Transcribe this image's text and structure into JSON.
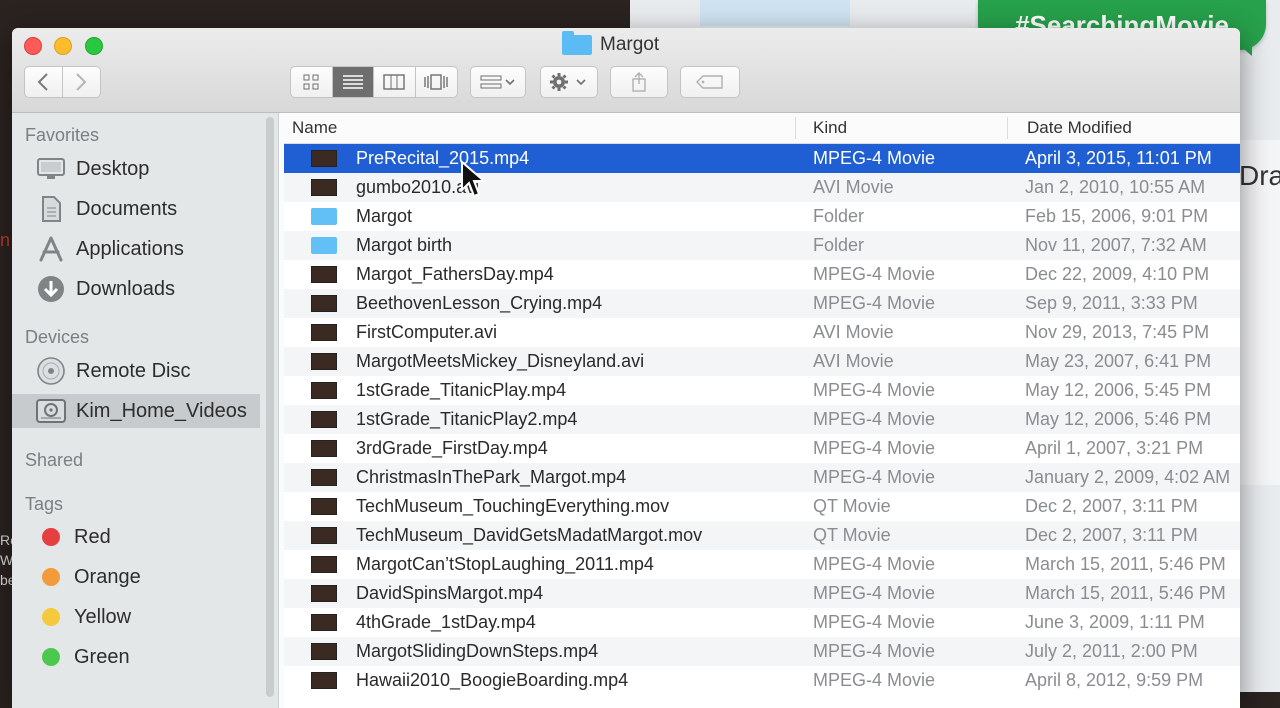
{
  "hashtag": "#SearchingMovie",
  "background": {
    "right_panel_text": "Drag",
    "left_text": "n",
    "left_strip": "Ro\nW\nbe"
  },
  "window": {
    "title": "Margot",
    "toolbar": {
      "view_icons": [
        "grid-icon",
        "list-icon",
        "columns-icon",
        "coverflow-icon"
      ],
      "arrange": "arrange-icon",
      "action": "gear-icon",
      "share": "share-icon",
      "tag": "tag-icon"
    }
  },
  "sidebar": {
    "favorites_header": "Favorites",
    "favorites": [
      "Desktop",
      "Documents",
      "Applications",
      "Downloads"
    ],
    "devices_header": "Devices",
    "devices": [
      "Remote Disc",
      "Kim_Home_Videos"
    ],
    "shared_header": "Shared",
    "tags_header": "Tags",
    "tags": [
      {
        "label": "Red",
        "color": "#e5403f"
      },
      {
        "label": "Orange",
        "color": "#f39a3a"
      },
      {
        "label": "Yellow",
        "color": "#f5c93e"
      },
      {
        "label": "Green",
        "color": "#4dc84f"
      }
    ]
  },
  "columns": {
    "name": "Name",
    "kind": "Kind",
    "date": "Date Modified"
  },
  "files": [
    {
      "name": "PreRecital_2015.mp4",
      "kind": "MPEG-4 Movie",
      "date": "April 3, 2015, 11:01 PM",
      "folder": false
    },
    {
      "name": "gumbo2010.avi",
      "kind": "AVI Movie",
      "date": "Jan 2, 2010, 10:55 AM",
      "folder": false
    },
    {
      "name": "Margot",
      "kind": "Folder",
      "date": "Feb 15, 2006, 9:01 PM",
      "folder": true
    },
    {
      "name": "Margot birth",
      "kind": "Folder",
      "date": "Nov 11, 2007, 7:32 AM",
      "folder": true
    },
    {
      "name": "Margot_FathersDay.mp4",
      "kind": "MPEG-4 Movie",
      "date": "Dec 22, 2009, 4:10 PM",
      "folder": false
    },
    {
      "name": "BeethovenLesson_Crying.mp4",
      "kind": "MPEG-4 Movie",
      "date": "Sep 9, 2011, 3:33 PM",
      "folder": false
    },
    {
      "name": "FirstComputer.avi",
      "kind": "AVI Movie",
      "date": "Nov 29, 2013, 7:45 PM",
      "folder": false
    },
    {
      "name": "MargotMeetsMickey_Disneyland.avi",
      "kind": "AVI Movie",
      "date": "May 23, 2007, 6:41 PM",
      "folder": false
    },
    {
      "name": "1stGrade_TitanicPlay.mp4",
      "kind": "MPEG-4 Movie",
      "date": "May 12, 2006, 5:45 PM",
      "folder": false
    },
    {
      "name": "1stGrade_TitanicPlay2.mp4",
      "kind": "MPEG-4 Movie",
      "date": "May 12, 2006, 5:46 PM",
      "folder": false
    },
    {
      "name": "3rdGrade_FirstDay.mp4",
      "kind": "MPEG-4 Movie",
      "date": "April 1, 2007, 3:21 PM",
      "folder": false
    },
    {
      "name": "ChristmasInThePark_Margot.mp4",
      "kind": "MPEG-4 Movie",
      "date": "January 2, 2009, 4:02 AM",
      "folder": false
    },
    {
      "name": "TechMuseum_TouchingEverything.mov",
      "kind": "QT Movie",
      "date": "Dec 2, 2007, 3:11 PM",
      "folder": false
    },
    {
      "name": "TechMuseum_DavidGetsMadatMargot.mov",
      "kind": "QT Movie",
      "date": "Dec 2, 2007, 3:11 PM",
      "folder": false
    },
    {
      "name": "MargotCan’tStopLaughing_2011.mp4",
      "kind": "MPEG-4 Movie",
      "date": "March 15, 2011, 5:46 PM",
      "folder": false
    },
    {
      "name": "DavidSpinsMargot.mp4",
      "kind": "MPEG-4 Movie",
      "date": "March 15, 2011, 5:46 PM",
      "folder": false
    },
    {
      "name": "4thGrade_1stDay.mp4",
      "kind": "MPEG-4 Movie",
      "date": "June 3, 2009, 1:11 PM",
      "folder": false
    },
    {
      "name": "MargotSlidingDownSteps.mp4",
      "kind": "MPEG-4 Movie",
      "date": "July 2, 2011, 2:00 PM",
      "folder": false
    },
    {
      "name": "Hawaii2010_BoogieBoarding.mp4",
      "kind": "MPEG-4 Movie",
      "date": "April 8, 2012, 9:59 PM",
      "folder": false
    }
  ],
  "selected_index": 0
}
